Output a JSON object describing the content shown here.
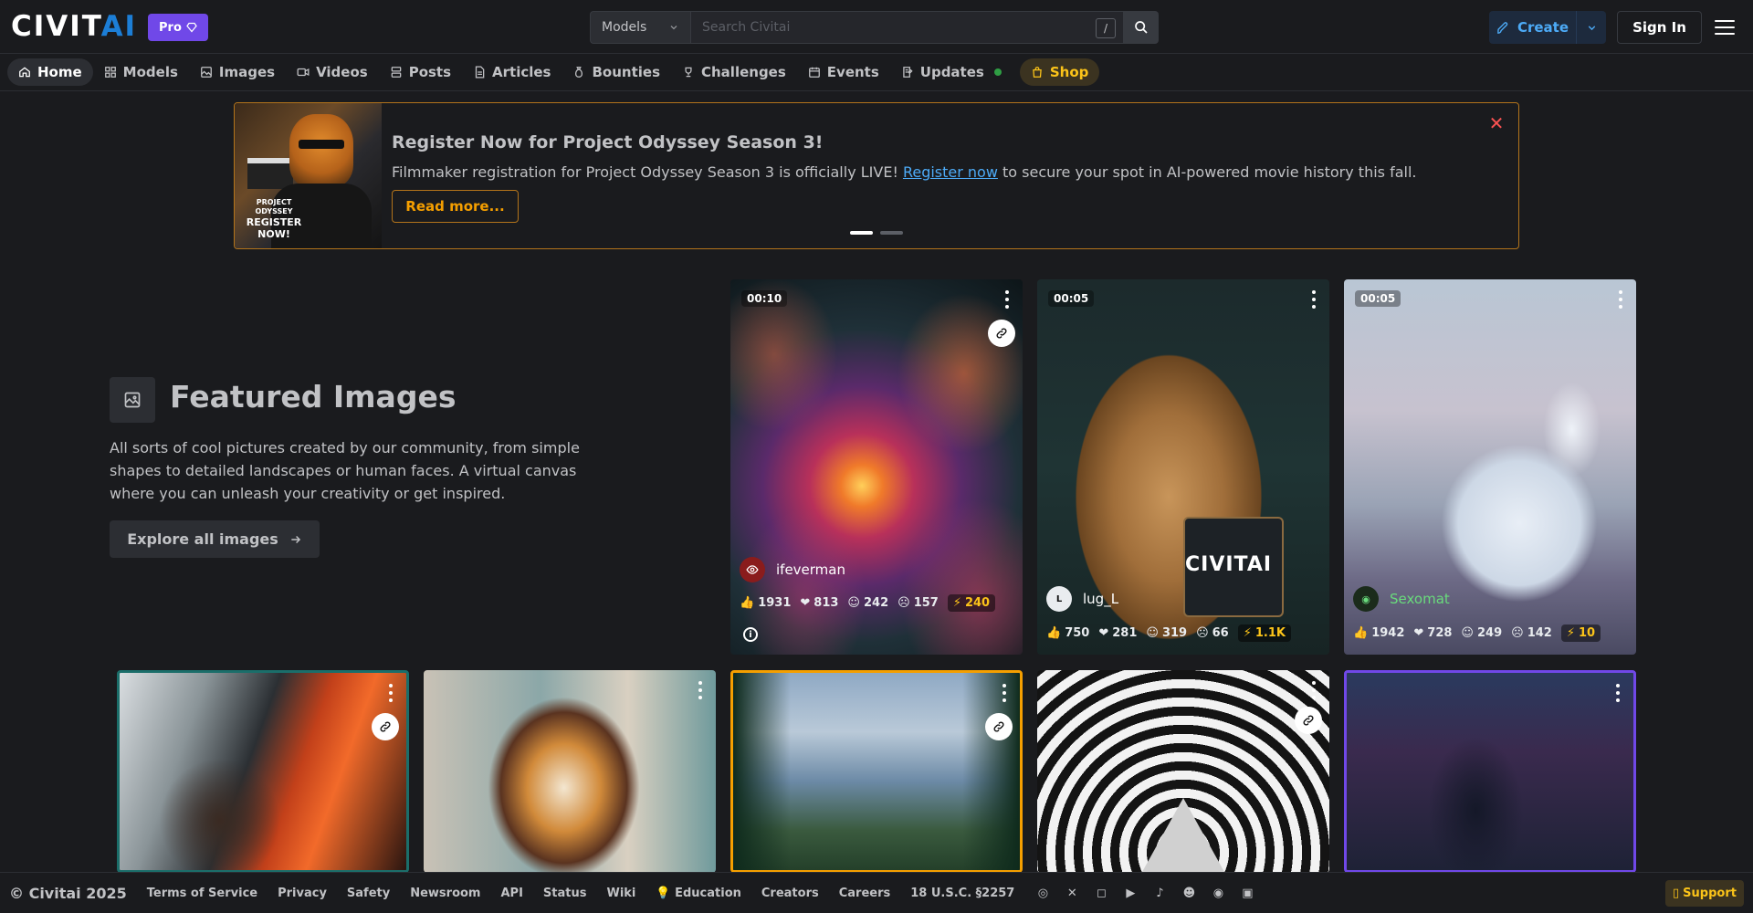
{
  "header": {
    "logo_text": "CIVIT",
    "logo_accent": "AI",
    "pro_label": "Pro",
    "search": {
      "category": "Models",
      "placeholder": "Search Civitai",
      "shortcut": "/"
    },
    "create_label": "Create",
    "signin_label": "Sign In"
  },
  "nav": {
    "items": [
      {
        "label": "Home",
        "icon": "home-icon"
      },
      {
        "label": "Models",
        "icon": "grid-icon"
      },
      {
        "label": "Images",
        "icon": "image-icon"
      },
      {
        "label": "Videos",
        "icon": "video-icon"
      },
      {
        "label": "Posts",
        "icon": "posts-icon"
      },
      {
        "label": "Articles",
        "icon": "article-icon"
      },
      {
        "label": "Bounties",
        "icon": "moneybag-icon"
      },
      {
        "label": "Challenges",
        "icon": "trophy-icon"
      },
      {
        "label": "Events",
        "icon": "calendar-icon"
      },
      {
        "label": "Updates",
        "icon": "updates-icon"
      },
      {
        "label": "Shop",
        "icon": "shopping-bag-icon"
      }
    ]
  },
  "announcement": {
    "title": "Register Now for Project Odyssey Season 3!",
    "text_before": "Filmmaker registration for Project Odyssey Season 3 is officially LIVE!",
    "link_text": "Register now",
    "text_after": "to secure your spot in AI-powered movie history this fall.",
    "button": "Read more...",
    "image_caption_small": "PROJECT ODYSSEY",
    "image_caption": "REGISTER NOW!"
  },
  "featured": {
    "title": "Featured Images",
    "description": "All sorts of cool pictures created by our community, from simple shapes to detailed landscapes or human faces. A virtual canvas where you can unleash your creativity or get inspired.",
    "button": "Explore all images"
  },
  "cards": [
    {
      "duration": "00:10",
      "user": "ifeverman",
      "likes": "1931",
      "hearts": "813",
      "laughs": "242",
      "cries": "157",
      "buzz": "240"
    },
    {
      "duration": "00:05",
      "user": "lug_L",
      "likes": "750",
      "hearts": "281",
      "laughs": "319",
      "cries": "66",
      "buzz": "1.1K"
    },
    {
      "duration": "00:05",
      "user": "Sexomat",
      "likes": "1942",
      "hearts": "728",
      "laughs": "249",
      "cries": "142",
      "buzz": "10"
    }
  ],
  "footer": {
    "copyright": "© Civitai 2025",
    "links": [
      "Terms of Service",
      "Privacy",
      "Safety",
      "Newsroom",
      "API",
      "Status",
      "Wiki",
      "💡 Education",
      "Creators",
      "Careers",
      "18 U.S.C. §2257"
    ],
    "support": "Support"
  },
  "colors": {
    "background": "#1a1b1e",
    "accent_blue": "#1c7ed6",
    "pro_purple": "#7048e8",
    "gold": "#fcc419",
    "banner_border": "#b3741b"
  }
}
